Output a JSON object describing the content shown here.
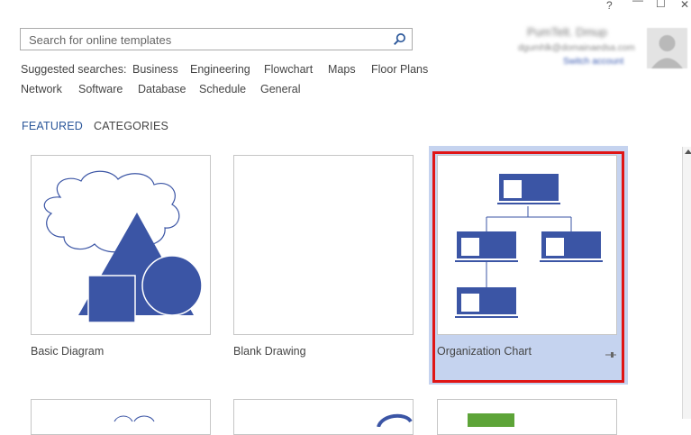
{
  "window": {
    "help": "?",
    "minimize": "—",
    "maximize": "☐",
    "close": "✕"
  },
  "search": {
    "placeholder": "Search for online templates",
    "value": ""
  },
  "suggested": {
    "label": "Suggested searches:",
    "items": [
      "Business",
      "Engineering",
      "Flowchart",
      "Maps",
      "Floor Plans",
      "Network",
      "Software",
      "Database",
      "Schedule",
      "General"
    ]
  },
  "user": {
    "name": "PumTelt. Dmup",
    "email": "dgumhlk@domainaedsa.com",
    "link": "Switch account"
  },
  "tabs": {
    "featured": "FEATURED",
    "categories": "CATEGORIES"
  },
  "templates": [
    {
      "label": "Basic Diagram"
    },
    {
      "label": "Blank Drawing"
    },
    {
      "label": "Organization Chart",
      "selected": true
    }
  ],
  "colors": {
    "accent": "#2b579a",
    "shape_fill": "#3b55a5",
    "selection": "#c5d3ef",
    "highlight": "#e01515"
  }
}
